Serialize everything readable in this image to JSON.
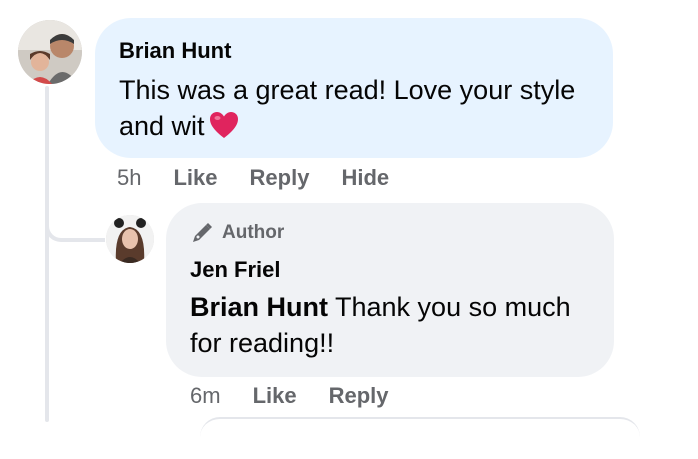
{
  "comments": [
    {
      "author": "Brian Hunt",
      "text": "This was a great read! Love your style and wit",
      "emoji": "heart",
      "time": "5h",
      "actions": [
        "Like",
        "Reply",
        "Hide"
      ]
    }
  ],
  "reply": {
    "badge": "Author",
    "author": "Jen Friel",
    "mention": "Brian Hunt",
    "text": " Thank you so much for reading!!",
    "time": "6m",
    "actions": [
      "Like",
      "Reply"
    ]
  },
  "colors": {
    "bubble_primary": "#e7f3ff",
    "bubble_secondary": "#f0f2f5",
    "meta_text": "#65676b",
    "heart": "#e0245e"
  }
}
